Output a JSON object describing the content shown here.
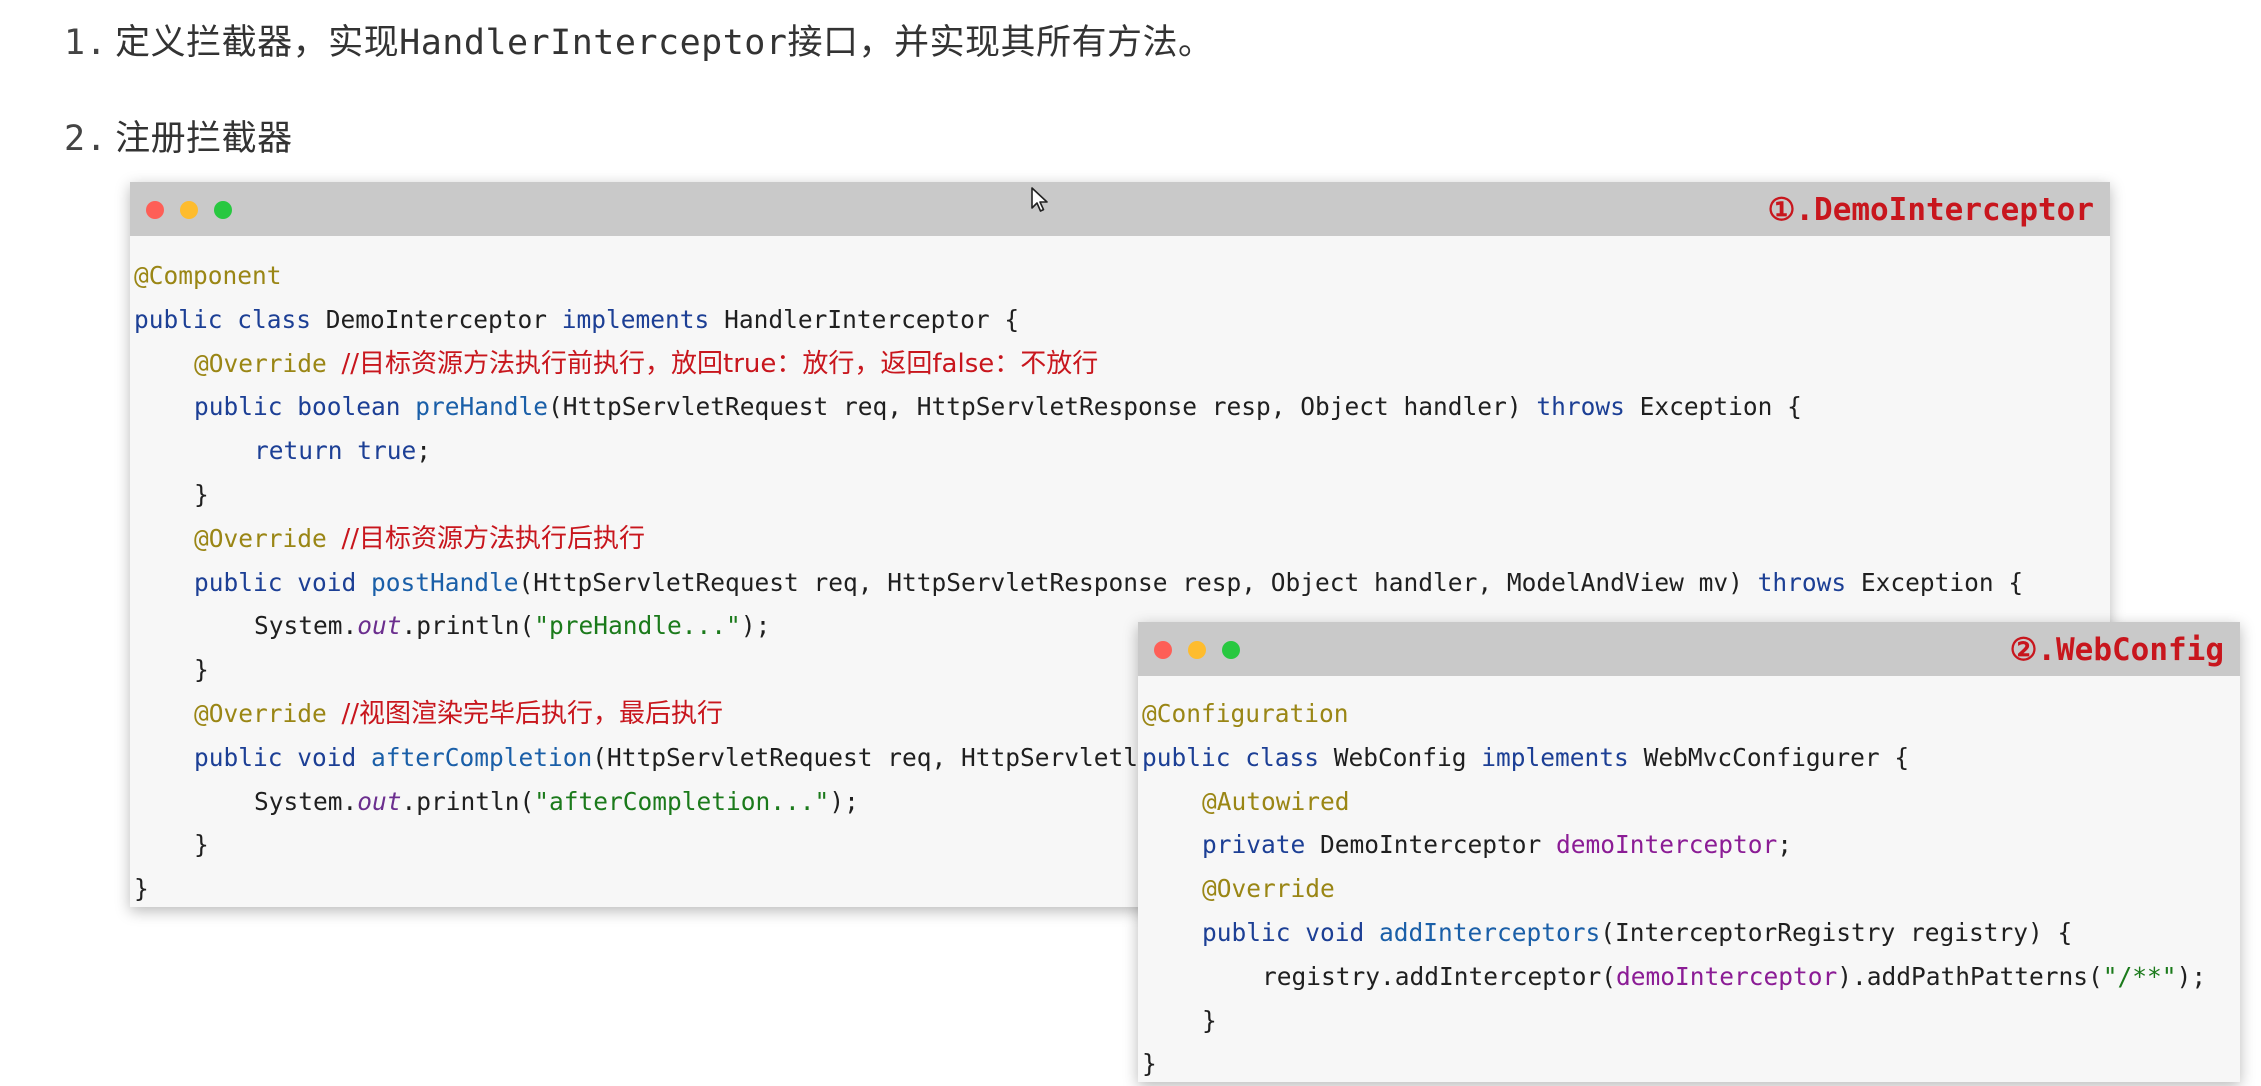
{
  "steps": [
    {
      "num": "1.",
      "text": "定义拦截器，实现HandlerInterceptor接口，并实现其所有方法。"
    },
    {
      "num": "2.",
      "text": "注册拦截器"
    }
  ],
  "window1": {
    "title": "①.DemoInterceptor",
    "code": {
      "l1": "@Component",
      "l2_public": "public ",
      "l2_class": "class ",
      "l2_name": "DemoInterceptor ",
      "l2_impl": "implements ",
      "l2_iface": "HandlerInterceptor {",
      "l3_ann": "@Override ",
      "l3_cmt": "//目标资源方法执行前执行，放回true：放行，返回false：不放行",
      "l4_public": "public ",
      "l4_bool": "boolean ",
      "l4_fn": "preHandle",
      "l4_args": "(HttpServletRequest req, HttpServletResponse resp, Object handler) ",
      "l4_throws": "throws ",
      "l4_exc": "Exception {",
      "l5_return": "return ",
      "l5_true": "true",
      "l5_semi": ";",
      "l6": "}",
      "l7_ann": "@Override ",
      "l7_cmt": "//目标资源方法执行后执行",
      "l8_public": "public ",
      "l8_void": "void ",
      "l8_fn": "postHandle",
      "l8_args": "(HttpServletRequest req, HttpServletResponse resp, Object handler, ModelAndView mv) ",
      "l8_throws": "throws ",
      "l8_exc": "Exception {",
      "l9_sys": "System.",
      "l9_out": "out",
      "l9_println": ".println(",
      "l9_str": "\"preHandle...\"",
      "l9_end": ");",
      "l10": "}",
      "l11_ann": "@Override ",
      "l11_cmt": "//视图渲染完毕后执行，最后执行",
      "l12_public": "public ",
      "l12_void": "void ",
      "l12_fn": "afterCompletion",
      "l12_args": "(HttpServletRequest req, HttpServletl",
      "l13_sys": "System.",
      "l13_out": "out",
      "l13_println": ".println(",
      "l13_str": "\"afterCompletion...\"",
      "l13_end": ");",
      "l14": "}",
      "l15": "}"
    }
  },
  "window2": {
    "title": "②.WebConfig",
    "code": {
      "l1": "@Configuration",
      "l2_public": "public ",
      "l2_class": "class ",
      "l2_name": "WebConfig ",
      "l2_impl": "implements ",
      "l2_iface": "WebMvcConfigurer {",
      "l3": "@Autowired",
      "l4_private": "private ",
      "l4_type": "DemoInterceptor ",
      "l4_field": "demoInterceptor",
      "l4_semi": ";",
      "l5": "@Override",
      "l6_public": "public ",
      "l6_void": "void ",
      "l6_fn": "addInterceptors",
      "l6_args": "(InterceptorRegistry registry) {",
      "l7_a": "registry.addInterceptor(",
      "l7_field": "demoInterceptor",
      "l7_b": ").addPathPatterns(",
      "l7_str": "\"/**\"",
      "l7_end": ");",
      "l8": "}",
      "l9": "}"
    }
  },
  "colors": {
    "comment": "#c8161d",
    "keyword": "#1c3f95",
    "annotation": "#9a8615",
    "string": "#1b7a1b",
    "field": "#8b1c95"
  },
  "icons": [
    "close-dot",
    "minimize-dot",
    "maximize-dot",
    "mouse-pointer-icon"
  ]
}
